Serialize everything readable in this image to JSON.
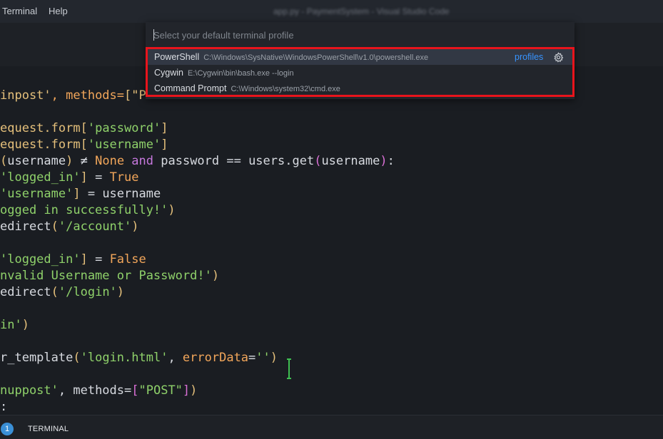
{
  "menubar": {
    "terminal": "Terminal",
    "help": "Help",
    "window_title": "app.py - PaymentSystem - Visual Studio Code"
  },
  "quick_pick": {
    "placeholder": "Select your default terminal profile",
    "items": [
      {
        "label": "PowerShell",
        "path": "C:\\Windows\\SysNative\\WindowsPowerShell\\v1.0\\powershell.exe",
        "action": "profiles"
      },
      {
        "label": "Cygwin",
        "path": "E:\\Cygwin\\bin\\bash.exe --login"
      },
      {
        "label": "Command Prompt",
        "path": "C:\\Windows\\system32\\cmd.exe"
      }
    ],
    "gear_icon": "gear-icon",
    "highlight_color": "#e8141c"
  },
  "editor": {
    "lines": [
      {
        "parts": [
          {
            "t": "inpost'",
            "c": "t-str"
          },
          {
            "t": ", methods=",
            "c": "t-org"
          },
          {
            "t": "[\"P",
            "c": "t-str"
          }
        ]
      },
      {
        "parts": []
      },
      {
        "parts": [
          {
            "t": "equest.form",
            "c": "t-str"
          },
          {
            "t": "[",
            "c": "t-str"
          },
          {
            "t": "'password'",
            "c": "t-str2"
          },
          {
            "t": "]",
            "c": "t-str"
          }
        ]
      },
      {
        "parts": [
          {
            "t": "equest.form",
            "c": "t-str"
          },
          {
            "t": "[",
            "c": "t-str"
          },
          {
            "t": "'username'",
            "c": "t-str2"
          },
          {
            "t": "]",
            "c": "t-str"
          }
        ]
      },
      {
        "parts": [
          {
            "t": "(",
            "c": "t-str"
          },
          {
            "t": "username",
            "c": "t-txt"
          },
          {
            "t": ")",
            "c": "t-str"
          },
          {
            "t": " ≠ ",
            "c": "t-txt"
          },
          {
            "t": "None",
            "c": "t-org"
          },
          {
            "t": " and ",
            "c": "t-kw"
          },
          {
            "t": "password == users.get",
            "c": "t-txt"
          },
          {
            "t": "(",
            "c": "t-br2"
          },
          {
            "t": "username",
            "c": "t-txt"
          },
          {
            "t": ")",
            "c": "t-br2"
          },
          {
            "t": ":",
            "c": "t-txt"
          }
        ]
      },
      {
        "parts": [
          {
            "t": "'logged_in'",
            "c": "t-str2"
          },
          {
            "t": "]",
            "c": "t-str"
          },
          {
            "t": " = ",
            "c": "t-txt"
          },
          {
            "t": "True",
            "c": "t-org"
          }
        ]
      },
      {
        "parts": [
          {
            "t": "'username'",
            "c": "t-str2"
          },
          {
            "t": "]",
            "c": "t-str"
          },
          {
            "t": " = username",
            "c": "t-txt"
          }
        ]
      },
      {
        "parts": [
          {
            "t": "ogged in successfully!'",
            "c": "t-str2"
          },
          {
            "t": ")",
            "c": "t-str"
          }
        ]
      },
      {
        "parts": [
          {
            "t": "edirect",
            "c": "t-txt"
          },
          {
            "t": "(",
            "c": "t-str"
          },
          {
            "t": "'/account'",
            "c": "t-str2"
          },
          {
            "t": ")",
            "c": "t-str"
          }
        ]
      },
      {
        "parts": []
      },
      {
        "parts": [
          {
            "t": "'logged_in'",
            "c": "t-str2"
          },
          {
            "t": "]",
            "c": "t-str"
          },
          {
            "t": " = ",
            "c": "t-txt"
          },
          {
            "t": "False",
            "c": "t-org"
          }
        ]
      },
      {
        "parts": [
          {
            "t": "nvalid Username or Password!'",
            "c": "t-str2"
          },
          {
            "t": ")",
            "c": "t-str"
          }
        ]
      },
      {
        "parts": [
          {
            "t": "edirect",
            "c": "t-txt"
          },
          {
            "t": "(",
            "c": "t-str"
          },
          {
            "t": "'/login'",
            "c": "t-str2"
          },
          {
            "t": ")",
            "c": "t-str"
          }
        ]
      },
      {
        "parts": []
      },
      {
        "parts": [
          {
            "t": "in'",
            "c": "t-str2"
          },
          {
            "t": ")",
            "c": "t-str"
          }
        ]
      },
      {
        "parts": []
      },
      {
        "parts": [
          {
            "t": "r_template",
            "c": "t-txt"
          },
          {
            "t": "(",
            "c": "t-str"
          },
          {
            "t": "'login.html'",
            "c": "t-str2"
          },
          {
            "t": ", ",
            "c": "t-txt"
          },
          {
            "t": "errorData",
            "c": "t-org"
          },
          {
            "t": "=",
            "c": "t-txt"
          },
          {
            "t": "''",
            "c": "t-str2"
          },
          {
            "t": ")",
            "c": "t-str"
          }
        ]
      },
      {
        "parts": []
      },
      {
        "parts": [
          {
            "t": "nuppost'",
            "c": "t-str2"
          },
          {
            "t": ", methods=",
            "c": "t-txt"
          },
          {
            "t": "[",
            "c": "t-br2"
          },
          {
            "t": "\"POST\"",
            "c": "t-str2"
          },
          {
            "t": "]",
            "c": "t-br2"
          },
          {
            "t": ")",
            "c": "t-str"
          }
        ]
      },
      {
        "parts": [
          {
            "t": ":",
            "c": "t-txt"
          }
        ]
      }
    ]
  },
  "panel": {
    "badge_count": "1",
    "terminal_tab": "TERMINAL"
  }
}
